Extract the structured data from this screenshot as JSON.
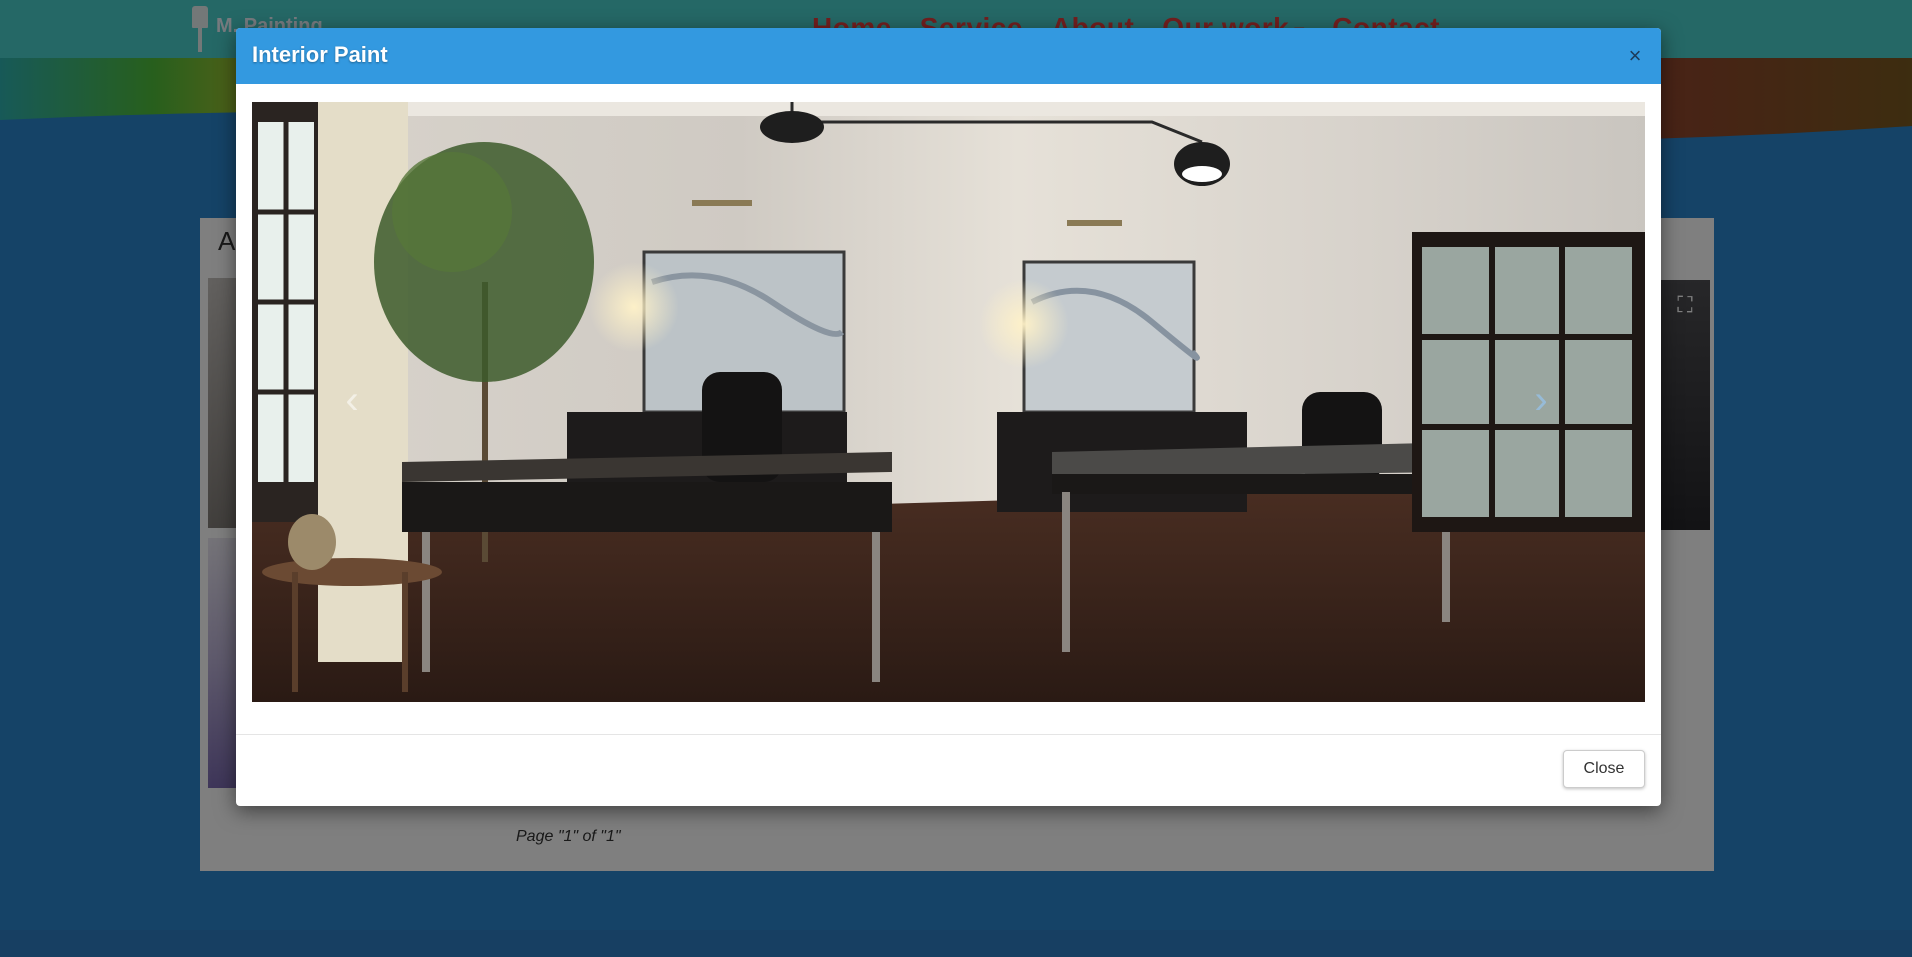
{
  "site": {
    "logo_text": "M. Painting",
    "nav": [
      "Home",
      "Service",
      "About",
      "Our work",
      "Contact"
    ],
    "nav_dropdown_icon": "caret-down-icon",
    "album_title": "A",
    "pager_text": "Page \"1\" of \"1\"",
    "expand_icon": "fullscreen-icon"
  },
  "modal": {
    "title": "Interior Paint",
    "close_x": "×",
    "close_button": "Close",
    "prev_icon": "chevron-left-icon",
    "next_icon": "chevron-right-icon"
  },
  "colors": {
    "navbar": "#4ad0cc",
    "nav_link": "#e63f3f",
    "modal_header": "#3399e0",
    "page_bg": "#2b86cf"
  }
}
